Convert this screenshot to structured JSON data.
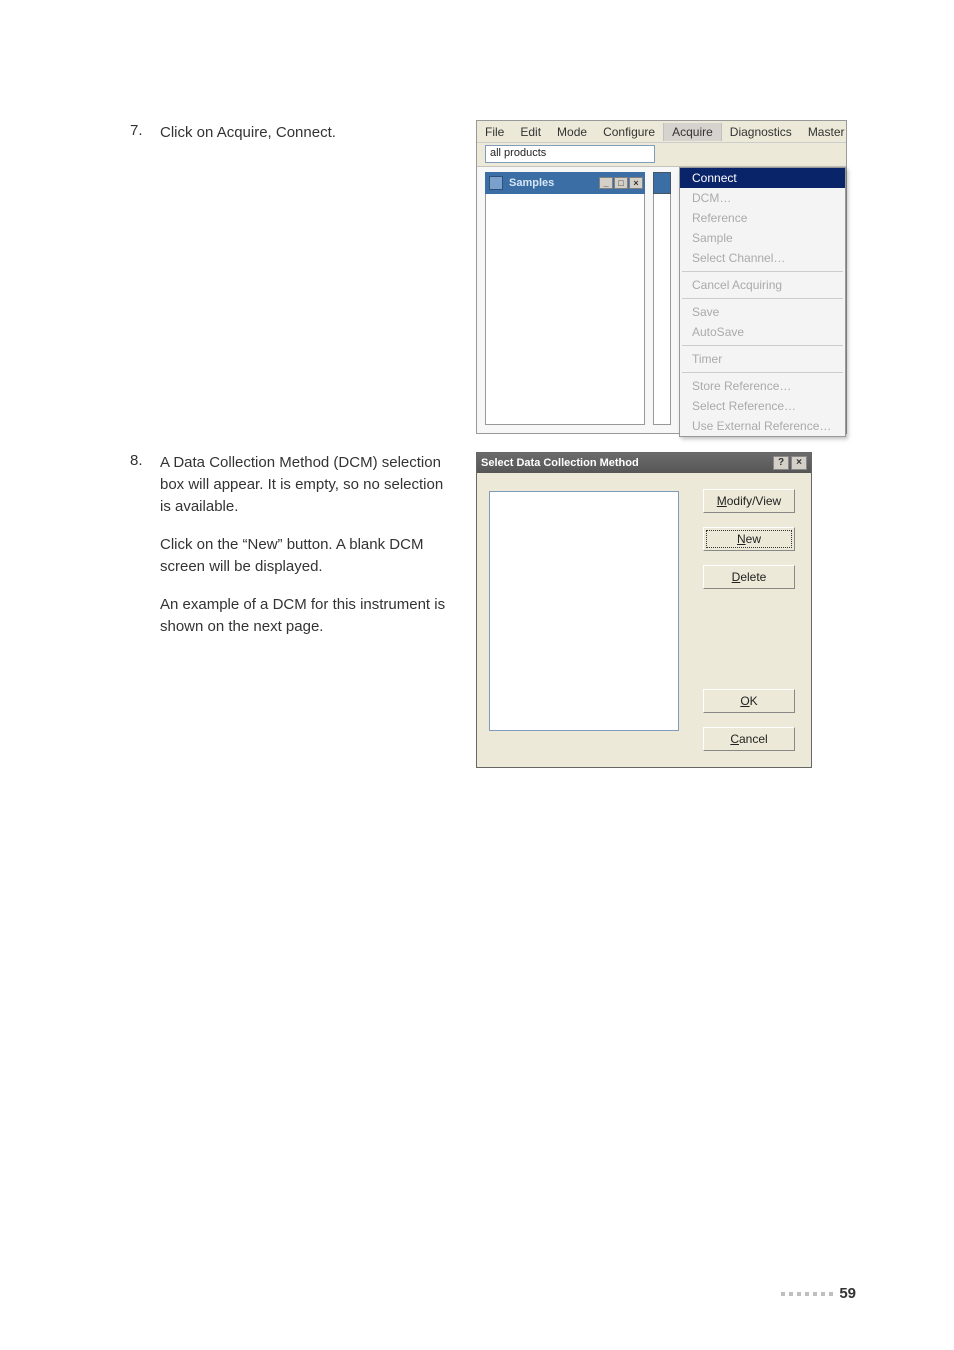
{
  "steps": {
    "s7": {
      "num": "7.",
      "text": "Click on Acquire, Connect."
    },
    "s8": {
      "num": "8.",
      "p1": "A Data Collection Method (DCM) selection box will appear. It is empty, so no selection is available.",
      "p2": "Click on the “New” button. A blank DCM screen will be displayed.",
      "p3": "An example of a DCM for this instrument is shown on the next page."
    }
  },
  "menubar": {
    "file": "File",
    "edit": "Edit",
    "mode": "Mode",
    "configure": "Configure",
    "acquire": "Acquire",
    "diagnostics": "Diagnostics",
    "master": "Master"
  },
  "combo_value": "all products",
  "samples_title": "Samples",
  "acquire_menu": {
    "connect": "Connect",
    "dcm": "DCM…",
    "reference": "Reference",
    "sample": "Sample",
    "select_channel": "Select Channel…",
    "cancel_acq": "Cancel Acquiring",
    "save": "Save",
    "autosave": "AutoSave",
    "timer": "Timer",
    "store_ref": "Store Reference…",
    "select_ref": "Select Reference…",
    "use_ext_ref": "Use External Reference…"
  },
  "dialog": {
    "title": "Select Data Collection Method",
    "help": "?",
    "close": "×",
    "modify": "Modify/View",
    "modify_u": "M",
    "new": "New",
    "new_u": "N",
    "delete": "Delete",
    "delete_u": "D",
    "ok": "OK",
    "ok_u": "O",
    "ok_rest": "K",
    "cancel": "Cancel",
    "cancel_u": "C",
    "cancel_rest": "ancel"
  },
  "page_number": "59"
}
